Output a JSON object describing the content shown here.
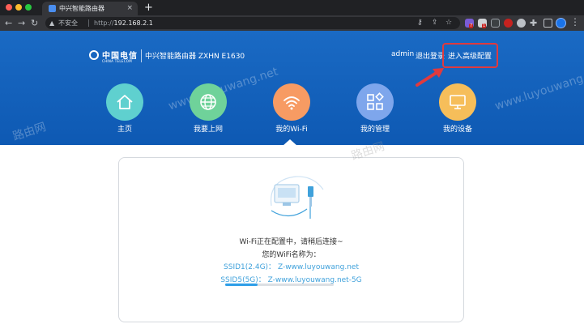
{
  "browser": {
    "tab_title": "中兴智能路由器",
    "tab_close": "×",
    "new_tab": "+",
    "security_label": "不安全",
    "url_scheme": "http://",
    "url_host": "192.168.2.1",
    "ext_badge_1": "7",
    "ext_badge_2": "1"
  },
  "header": {
    "logo_cn": "中国电信",
    "logo_en": "CHINA TELECOM",
    "product_name": "中兴智能路由器 ZXHN E1630",
    "user": "admin",
    "logout": "退出登录",
    "advanced": "进入高级配置"
  },
  "nav": {
    "items": [
      {
        "label": "主页",
        "icon": "home-icon",
        "color": "#5fd0cf"
      },
      {
        "label": "我要上网",
        "icon": "globe-icon",
        "color": "#6fd29a"
      },
      {
        "label": "我的Wi-Fi",
        "icon": "wifi-icon",
        "color": "#f79b63"
      },
      {
        "label": "我的管理",
        "icon": "grid-icon",
        "color": "#7ea6ec"
      },
      {
        "label": "我的设备",
        "icon": "monitor-icon",
        "color": "#f6be5a"
      }
    ],
    "active_index": 2
  },
  "content": {
    "status": "Wi-Fi正在配置中，请稍后连接~",
    "wifi_name_label": "您的WiFi名称为：",
    "ssid1_label": "SSID1(2.4G)：",
    "ssid1_value": "Z-www.luyouwang.net",
    "ssid5_label": "SSID5(5G)：",
    "ssid5_value": "Z-www.luyouwang.net-5G",
    "progress": 0.3
  },
  "watermarks": {
    "text_1": "www.luyouwang.net",
    "text_2": "路由网",
    "text_3": "www.luyouwang.net",
    "text_4": "路由网"
  },
  "colors": {
    "header_bg": "#1565c0",
    "highlight": "#e03a3e",
    "accent": "#3fa1db"
  }
}
